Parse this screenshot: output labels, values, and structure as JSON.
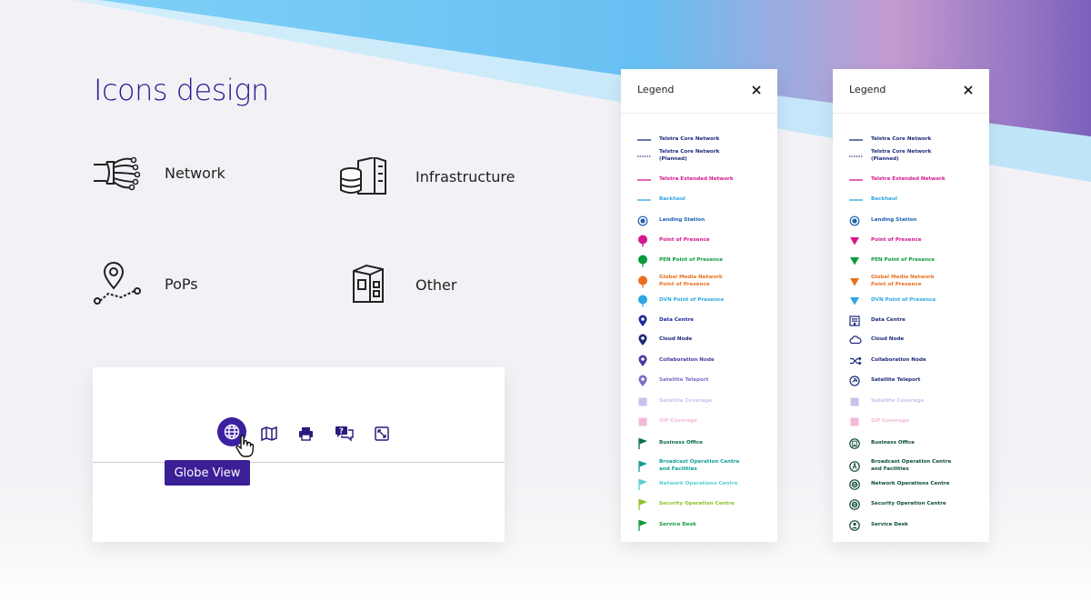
{
  "heading": "Icons design",
  "categories": {
    "network": "Network",
    "infrastructure": "Infrastructure",
    "pops": "PoPs",
    "other": "Other"
  },
  "toolbar": {
    "tooltip": "Globe View",
    "icons": [
      "globe-icon",
      "map-icon",
      "print-icon",
      "help-chat-icon",
      "fullscreen-icon"
    ]
  },
  "colors": {
    "brand_purple": "#3b20a0",
    "navy": "#1c2a78",
    "magenta": "#d6178c",
    "green": "#0a9a3e",
    "orange": "#e8711e",
    "light_blue": "#2ea6e0",
    "indigo": "#3b2a9a",
    "lavender": "#7b6cc4",
    "light_lavender": "#c9c2ea",
    "pink_light": "#f3b9da",
    "teal": "#0f9e96",
    "aqua": "#56d0cf",
    "lime": "#8cc12a",
    "dark_green": "#0d6b4c"
  },
  "legend_left": {
    "title": "Legend",
    "items": [
      {
        "label": "Telstra Core Network",
        "color": "#1c2a78",
        "icon": "solid-line"
      },
      {
        "label": "Telstra Core Network\n(Planned)",
        "color": "#1c2a78",
        "icon": "dotted-line"
      },
      {
        "label": "Telstra Extended Network",
        "color": "#d6178c",
        "icon": "solid-line"
      },
      {
        "label": "Backhaul",
        "color": "#2ea6e0",
        "icon": "solid-line"
      },
      {
        "label": "Landing Station",
        "color": "#1c5fb0",
        "icon": "ring-dot"
      },
      {
        "label": "Point of Presence",
        "color": "#d6178c",
        "icon": "pin"
      },
      {
        "label": "PEN Point of Presence",
        "color": "#0a9a3e",
        "icon": "pin"
      },
      {
        "label": "Global Media Network\nPoint of Presence",
        "color": "#e8711e",
        "icon": "pin"
      },
      {
        "label": "DVN Point of Presence",
        "color": "#2ea6e0",
        "icon": "pin"
      },
      {
        "label": "Data Centre",
        "color": "#1c2a9a",
        "icon": "map-pin"
      },
      {
        "label": "Cloud Node",
        "color": "#1c2a78",
        "icon": "map-pin"
      },
      {
        "label": "Collaboration Node",
        "color": "#4a3aa0",
        "icon": "map-pin"
      },
      {
        "label": "Satellite Teleport",
        "color": "#7b6cc4",
        "icon": "map-pin"
      },
      {
        "label": "Satellite Coverage",
        "color": "#c9c2ea",
        "icon": "square"
      },
      {
        "label": "SIP Coverage",
        "color": "#f3b9da",
        "icon": "square"
      },
      {
        "label": "Business Office",
        "color": "#0d6b4c",
        "icon": "flag"
      },
      {
        "label": "Broadcast Operation Centre\nand Facilities",
        "color": "#0f9e96",
        "icon": "flag"
      },
      {
        "label": "Network Operations Centre",
        "color": "#56d0cf",
        "icon": "flag"
      },
      {
        "label": "Security Operation Centre",
        "color": "#8cc12a",
        "icon": "flag"
      },
      {
        "label": "Service Desk",
        "color": "#0a9a3e",
        "icon": "flag"
      }
    ]
  },
  "legend_right": {
    "title": "Legend",
    "items": [
      {
        "label": "Telstra Core Network",
        "color": "#1c2a78",
        "icon": "solid-line"
      },
      {
        "label": "Telstra Core Network\n(Planned)",
        "color": "#1c2a78",
        "icon": "dotted-line"
      },
      {
        "label": "Telstra Extended Network",
        "color": "#d6178c",
        "icon": "solid-line"
      },
      {
        "label": "Backhaul",
        "color": "#2ea6e0",
        "icon": "solid-line"
      },
      {
        "label": "Landing Station",
        "color": "#1c5fb0",
        "icon": "ring-dot"
      },
      {
        "label": "Point of Presence",
        "color": "#d6178c",
        "icon": "triangle"
      },
      {
        "label": "PEN Point of Presence",
        "color": "#0a9a3e",
        "icon": "triangle"
      },
      {
        "label": "Global Media Network\nPoint of Presence",
        "color": "#e8711e",
        "icon": "triangle"
      },
      {
        "label": "DVN Point of Presence",
        "color": "#2ea6e0",
        "icon": "triangle"
      },
      {
        "label": "Data Centre",
        "color": "#1c2a78",
        "icon": "building"
      },
      {
        "label": "Cloud Node",
        "color": "#1c2a78",
        "icon": "cloud"
      },
      {
        "label": "Collaboration Node",
        "color": "#1c2a78",
        "icon": "shuffle"
      },
      {
        "label": "Satellite Teleport",
        "color": "#1c2a78",
        "icon": "satellite"
      },
      {
        "label": "Satellite Coverage",
        "color": "#c9c2ea",
        "icon": "square"
      },
      {
        "label": "SIP Coverage",
        "color": "#f3b9da",
        "icon": "square"
      },
      {
        "label": "Business Office",
        "color": "#0d4a3a",
        "icon": "circle-building"
      },
      {
        "label": "Broadcast Operation Centre\nand Facilities",
        "color": "#0d4a3a",
        "icon": "circle-tower"
      },
      {
        "label": "Network Operations Centre",
        "color": "#0d4a3a",
        "icon": "circle-globe"
      },
      {
        "label": "Security Operation Centre",
        "color": "#0d4a3a",
        "icon": "circle-globe"
      },
      {
        "label": "Service Desk",
        "color": "#0d4a3a",
        "icon": "circle-person"
      }
    ]
  }
}
